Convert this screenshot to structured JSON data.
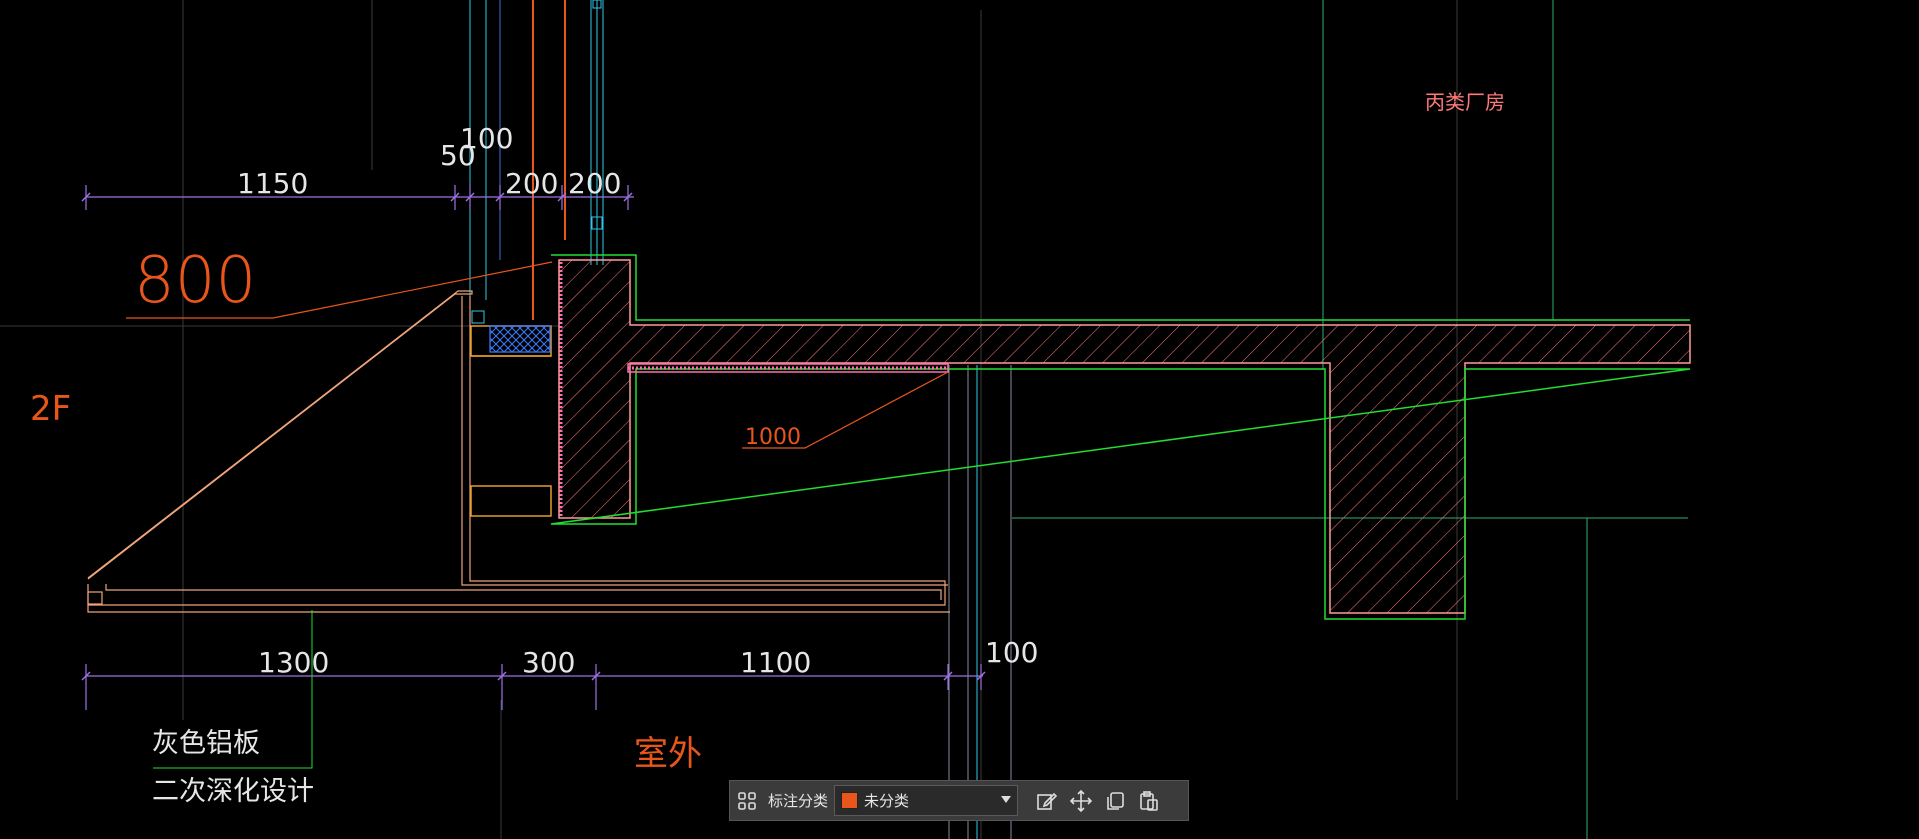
{
  "drawing": {
    "labels": {
      "building_type": "丙类厂房",
      "level": "2F",
      "outside": "室外",
      "material_line1": "灰色铝板",
      "material_line2": "二次深化设计",
      "leader_800": "800",
      "leader_1000": "1000"
    },
    "dims_top": {
      "d1150": "1150",
      "d50": "50",
      "d100": "100",
      "d200a": "200",
      "d200b": "200"
    },
    "dims_bottom": {
      "d1300": "1300",
      "d300": "300",
      "d1100": "1100",
      "d100": "100"
    }
  },
  "toolbar": {
    "label": "标注分类",
    "selected": "未分类",
    "swatch_color": "#e8561c",
    "icons": [
      "grid-icon",
      "edit-icon",
      "move-icon",
      "copy-icon",
      "paste-icon"
    ]
  },
  "colors": {
    "background": "#000000",
    "dimension": "#a070e6",
    "concrete": "#ff7a7a",
    "outline_green": "#22dd33",
    "orange": "#e8561c",
    "cyan": "#31c7e8"
  }
}
